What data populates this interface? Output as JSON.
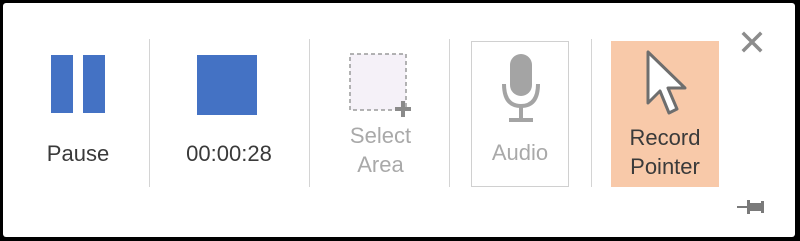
{
  "toolbar": {
    "pause": {
      "label": "Pause",
      "icon": "pause-icon"
    },
    "stop": {
      "label": "00:00:28",
      "icon": "stop-icon"
    },
    "select_area": {
      "label": "Select\nArea",
      "icon": "select-area-icon",
      "enabled": false
    },
    "audio": {
      "label": "Audio",
      "icon": "microphone-icon",
      "toggled": false,
      "enabled": false
    },
    "record_pointer": {
      "label": "Record\nPointer",
      "icon": "pointer-icon",
      "toggled": true
    },
    "close": {
      "icon": "close-icon"
    },
    "pin": {
      "icon": "pin-icon"
    }
  },
  "colors": {
    "accent": "#4472c4",
    "toggled_background": "#f8c9a9",
    "disabled": "#a9a9a9",
    "label": "#3a3a3a"
  }
}
